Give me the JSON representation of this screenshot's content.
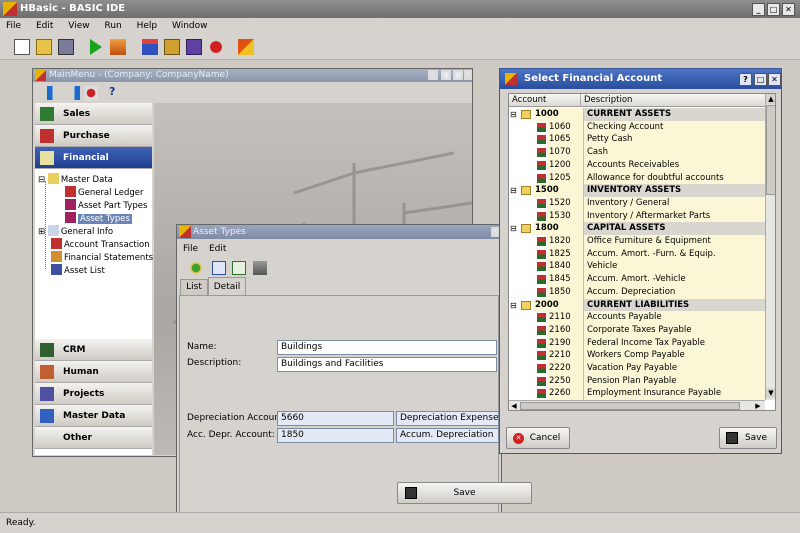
{
  "app": {
    "title": "HBasic - BASIC IDE",
    "status": "Ready."
  },
  "menubar": [
    "File",
    "Edit",
    "View",
    "Run",
    "Help",
    "Window"
  ],
  "main_menu": {
    "title": "MainMenu - (Company: CompanyName)",
    "nav_top": [
      "Sales",
      "Purchase",
      "Financial"
    ],
    "nav_bottom": [
      "CRM",
      "Human Resources",
      "Projects",
      "Master Data",
      "Other"
    ],
    "tree": {
      "master_data": "Master Data",
      "general_ledger": "General Ledger",
      "asset_part_types": "Asset Part Types",
      "asset_types": "Asset Types",
      "general_info": "General Info",
      "account_transaction": "Account Transaction",
      "financial_statements": "Financial Statements",
      "asset_list": "Asset List"
    }
  },
  "asset_types": {
    "title": "Asset Types",
    "menu": [
      "File",
      "Edit"
    ],
    "tabs": [
      "List",
      "Detail"
    ],
    "name_label": "Name:",
    "name_value": "Buildings",
    "desc_label": "Description:",
    "desc_value": "Buildings and Facilities",
    "dep_label": "Depreciation Account:",
    "dep_code": "5660",
    "dep_name": "Depreciation Expense",
    "acc_label": "Acc. Depr. Account:",
    "acc_code": "1850",
    "acc_name": "Accum. Depreciation",
    "save": "Save"
  },
  "fin_account": {
    "title": "Select Financial Account",
    "col_account": "Account",
    "col_description": "Description",
    "rows": [
      {
        "code": "1000",
        "desc": "CURRENT ASSETS",
        "group": true
      },
      {
        "code": "1060",
        "desc": "Checking Account"
      },
      {
        "code": "1065",
        "desc": "Petty Cash"
      },
      {
        "code": "1070",
        "desc": "Cash"
      },
      {
        "code": "1200",
        "desc": "Accounts Receivables"
      },
      {
        "code": "1205",
        "desc": "Allowance for doubtful accounts"
      },
      {
        "code": "1500",
        "desc": "INVENTORY ASSETS",
        "group": true
      },
      {
        "code": "1520",
        "desc": "Inventory / General"
      },
      {
        "code": "1530",
        "desc": "Inventory / Aftermarket Parts"
      },
      {
        "code": "1800",
        "desc": "CAPITAL ASSETS",
        "group": true
      },
      {
        "code": "1820",
        "desc": "Office Furniture & Equipment"
      },
      {
        "code": "1825",
        "desc": "Accum. Amort. -Furn. & Equip."
      },
      {
        "code": "1840",
        "desc": "Vehicle"
      },
      {
        "code": "1845",
        "desc": "Accum. Amort. -Vehicle"
      },
      {
        "code": "1850",
        "desc": "Accum. Depreciation"
      },
      {
        "code": "2000",
        "desc": "CURRENT LIABILITIES",
        "group": true
      },
      {
        "code": "2110",
        "desc": "Accounts Payable"
      },
      {
        "code": "2160",
        "desc": "Corporate Taxes Payable"
      },
      {
        "code": "2190",
        "desc": "Federal Income Tax Payable"
      },
      {
        "code": "2210",
        "desc": "Workers Comp Payable"
      },
      {
        "code": "2220",
        "desc": "Vacation Pay Payable"
      },
      {
        "code": "2250",
        "desc": "Pension Plan Payable"
      },
      {
        "code": "2260",
        "desc": "Employment Insurance Payable"
      }
    ],
    "cancel": "Cancel",
    "save": "Save"
  }
}
